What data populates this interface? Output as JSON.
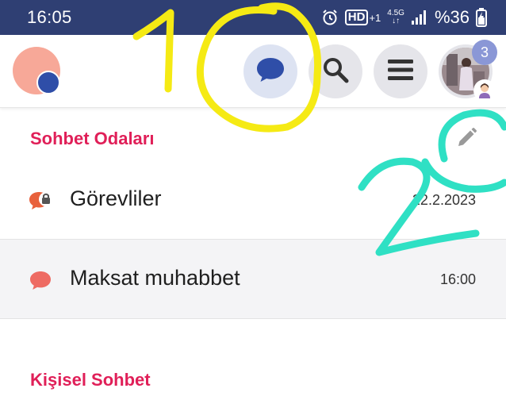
{
  "status_bar": {
    "time": "16:05",
    "alarm_icon": "alarm-icon",
    "hd_label": "HD",
    "hd_suffix": "+1",
    "network_label": "4.5G",
    "battery_text": "%36"
  },
  "app_bar": {
    "notification_count": "3"
  },
  "sections": {
    "rooms_title": "Sohbet Odaları",
    "personal_title": "Kişisel Sohbet"
  },
  "rooms": [
    {
      "name": "Görevliler",
      "time": "22.2.2023",
      "locked": true
    },
    {
      "name": "Maksat muhabbet",
      "time": "16:00",
      "locked": false
    }
  ],
  "annotations": {
    "mark_1": "1",
    "mark_2": "2"
  },
  "colors": {
    "status_bar": "#2f3f73",
    "accent_red": "#e01f58",
    "chat_icon_orange": "#e8613c",
    "chat_icon_blue": "#2f4ea8",
    "annotation_yellow": "#f5ea14",
    "annotation_teal": "#2fe0c4"
  }
}
